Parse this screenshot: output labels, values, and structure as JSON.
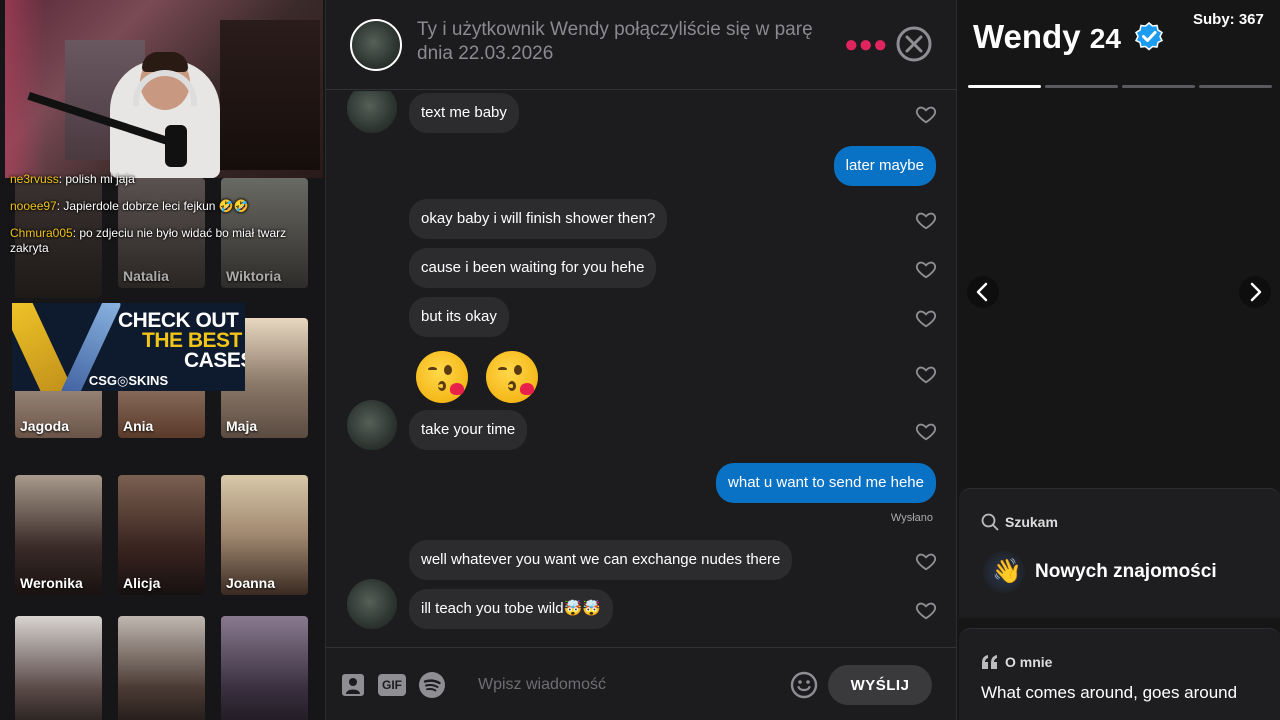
{
  "stream": {
    "chat": [
      {
        "user": "ne3rvuss",
        "text": "polish mi jaja"
      },
      {
        "user": "nooee97",
        "text": "Japierdole dobrze leci fejkun 🤣🤣"
      },
      {
        "user": "Chmura005",
        "text": "po zdjeciu nie było widać bo miał twarz zakryta"
      }
    ],
    "promo": {
      "line1": "CHECK OUT",
      "line2": "THE BEST",
      "line3": "CASES",
      "brand": "CSG◎SKINS"
    }
  },
  "matches_grid": [
    {
      "name": ""
    },
    {
      "name": "Natalia"
    },
    {
      "name": "Wiktoria"
    },
    {
      "name": "Jagoda"
    },
    {
      "name": "Ania"
    },
    {
      "name": "Maja"
    },
    {
      "name": "Weronika"
    },
    {
      "name": "Alicja"
    },
    {
      "name": "Joanna"
    },
    {
      "name": ""
    },
    {
      "name": ""
    },
    {
      "name": ""
    }
  ],
  "conversation": {
    "header_text": "Ty i użytkownik Wendy połączyliście się w parę dnia 22.03.2026",
    "messages": [
      {
        "dir": "in",
        "text": "text me baby"
      },
      {
        "dir": "out",
        "text": "later maybe"
      },
      {
        "dir": "in",
        "text": "okay baby i will finish shower then?"
      },
      {
        "dir": "in",
        "text": "cause i been waiting for you hehe"
      },
      {
        "dir": "in",
        "text": "but its okay"
      },
      {
        "dir": "in",
        "text": "😘 😘"
      },
      {
        "dir": "in",
        "text": "take your time"
      },
      {
        "dir": "out",
        "text": "what u want to send me hehe"
      },
      {
        "dir": "in",
        "text": "well whatever you want we can exchange nudes there"
      },
      {
        "dir": "in",
        "text": "ill teach you tobe wild🤯🤯"
      }
    ],
    "sent_status": "Wysłano",
    "composer": {
      "gif_label": "GIF",
      "placeholder": "Wpisz wiadomość",
      "send_label": "WYŚLIJ"
    }
  },
  "profile": {
    "name": "Wendy",
    "age": "24",
    "subs": "Suby: 367",
    "photo_count": 4,
    "active_photo": 1,
    "looking_for": {
      "label": "Szukam",
      "value": "Nowych znajomości",
      "icon": "waving-hand-icon"
    },
    "about": {
      "label": "O mnie",
      "text": "What comes around, goes around"
    }
  },
  "colors": {
    "accent_blue": "#0a72c4",
    "dots_pink": "#e0245e",
    "chat_username": "#f0c419"
  }
}
